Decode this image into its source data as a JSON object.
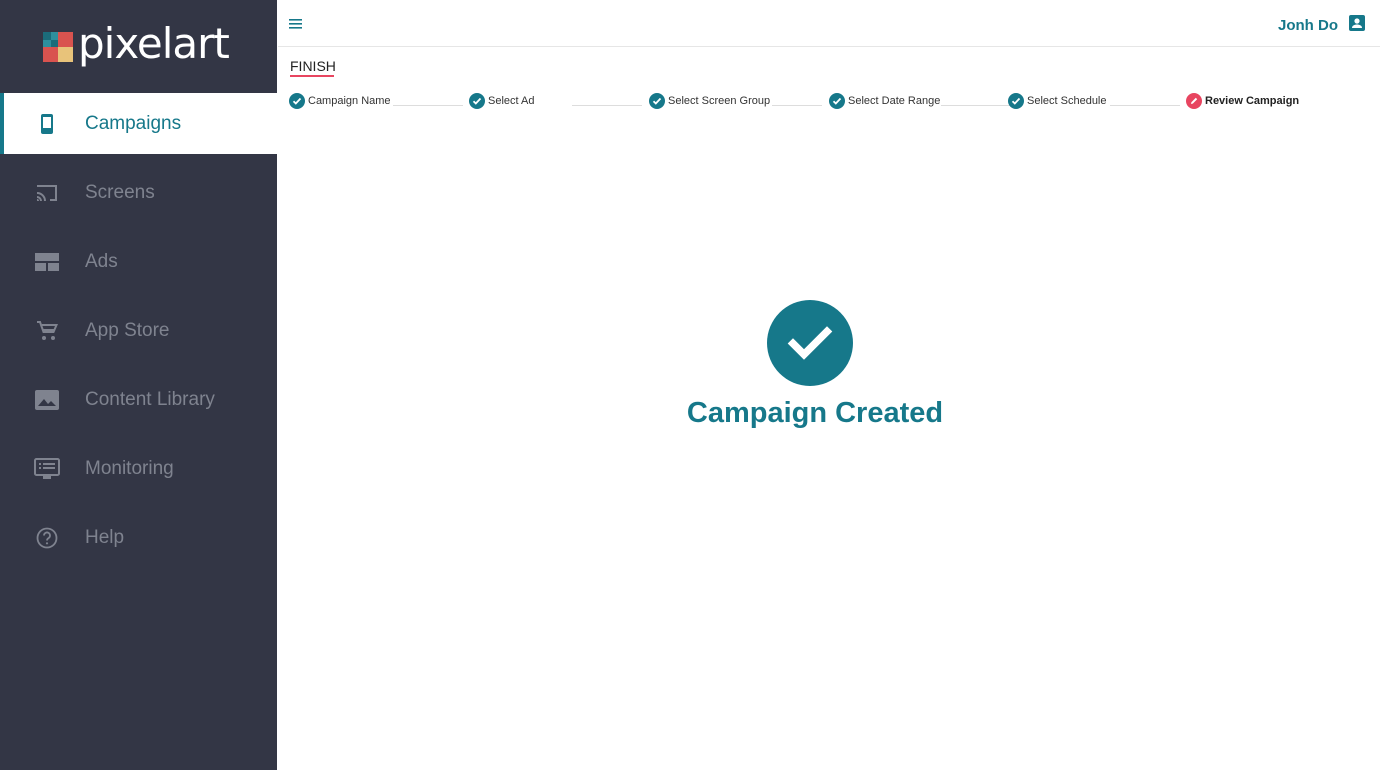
{
  "brand": {
    "name": "pixelart",
    "logo_colors": [
      "#1b6c7a",
      "#d9534f",
      "#e8c37a",
      "#2f8f9d"
    ]
  },
  "colors": {
    "accent": "#16788a",
    "sidebar_bg": "#333645",
    "sidebar_text": "#7f838f",
    "error_step": "#e84560"
  },
  "sidebar": {
    "items": [
      {
        "label": "Campaigns",
        "icon": "phone-icon",
        "active": true
      },
      {
        "label": "Screens",
        "icon": "cast-icon"
      },
      {
        "label": "Ads",
        "icon": "view-quilt-icon"
      },
      {
        "label": "App Store",
        "icon": "shopping-cart-icon"
      },
      {
        "label": "Content Library",
        "icon": "image-icon"
      },
      {
        "label": "Monitoring",
        "icon": "monitor-list-icon"
      },
      {
        "label": "Help",
        "icon": "help-circle-icon"
      }
    ]
  },
  "header": {
    "menu_icon": "menu-icon",
    "user_name": "Jonh Do",
    "user_icon": "account-box-icon"
  },
  "wizard": {
    "heading": "FINISH",
    "steps": [
      {
        "label": "Campaign Name",
        "status": "done"
      },
      {
        "label": "Select Ad",
        "status": "done"
      },
      {
        "label": "Select Screen Group",
        "status": "done"
      },
      {
        "label": "Select Date Range",
        "status": "done"
      },
      {
        "label": "Select Schedule",
        "status": "done"
      },
      {
        "label": "Review Campaign",
        "status": "current"
      }
    ]
  },
  "result": {
    "icon": "check-circle-icon",
    "title": "Campaign Created"
  }
}
